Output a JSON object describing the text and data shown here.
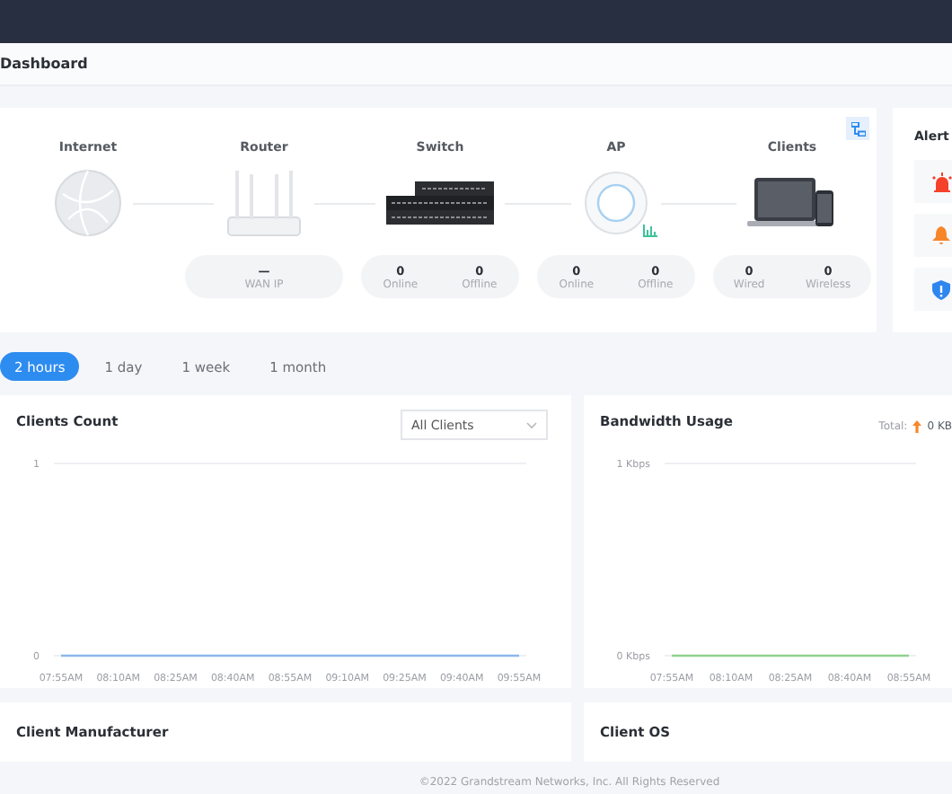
{
  "header": {
    "title": "Dashboard"
  },
  "topology": {
    "devices": [
      {
        "kind": "globe",
        "label": "Internet"
      },
      {
        "kind": "router",
        "label": "Router",
        "stats": [
          {
            "value": "—",
            "caption": "WAN IP"
          }
        ]
      },
      {
        "kind": "switch",
        "label": "Switch",
        "stats": [
          {
            "value": "0",
            "caption": "Online"
          },
          {
            "value": "0",
            "caption": "Offline"
          }
        ]
      },
      {
        "kind": "ap",
        "label": "AP",
        "stats": [
          {
            "value": "0",
            "caption": "Online"
          },
          {
            "value": "0",
            "caption": "Offline"
          }
        ]
      },
      {
        "kind": "laptop",
        "label": "Clients",
        "stats": [
          {
            "value": "0",
            "caption": "Wired"
          },
          {
            "value": "0",
            "caption": "Wireless"
          }
        ]
      }
    ]
  },
  "alert": {
    "title": "Alert",
    "items": [
      {
        "kind": "siren",
        "color": "#f5412a"
      },
      {
        "kind": "bell",
        "color": "#f7862a"
      },
      {
        "kind": "shield",
        "color": "#2f86ee"
      }
    ]
  },
  "ranges": [
    {
      "label": "2 hours",
      "selected": true
    },
    {
      "label": "1 day",
      "selected": false
    },
    {
      "label": "1 week",
      "selected": false
    },
    {
      "label": "1 month",
      "selected": false
    }
  ],
  "clients_count": {
    "title": "Clients Count",
    "filter": "All Clients",
    "chart_data": {
      "type": "line",
      "categories": [
        "07:55AM",
        "08:10AM",
        "08:25AM",
        "08:40AM",
        "08:55AM",
        "09:10AM",
        "09:25AM",
        "09:40AM",
        "09:55AM"
      ],
      "yticks": [
        0,
        1
      ],
      "ylim": [
        0,
        1
      ],
      "series": [
        {
          "color": "#8ab8ea",
          "values": [
            0,
            0,
            0,
            0,
            0,
            0,
            0,
            0,
            0
          ]
        }
      ]
    }
  },
  "bandwidth": {
    "title": "Bandwidth Usage",
    "total_label": "Total:",
    "upload": "0 KB",
    "chart_data": {
      "type": "line",
      "categories": [
        "07:55AM",
        "08:10AM",
        "08:25AM",
        "08:40AM",
        "08:55AM"
      ],
      "yticks": [
        {
          "value": 0,
          "label": "0 Kbps"
        },
        {
          "value": 1,
          "label": "1 Kbps"
        }
      ],
      "ylim": [
        0,
        1
      ],
      "series": [
        {
          "color": "#8fd18f",
          "values": [
            0,
            0,
            0,
            0,
            0
          ]
        }
      ]
    }
  },
  "bottom_cards": [
    {
      "title": "Client Manufacturer"
    },
    {
      "title": "Client OS"
    }
  ],
  "footer": "©2022 Grandstream Networks, Inc. All Rights Reserved"
}
